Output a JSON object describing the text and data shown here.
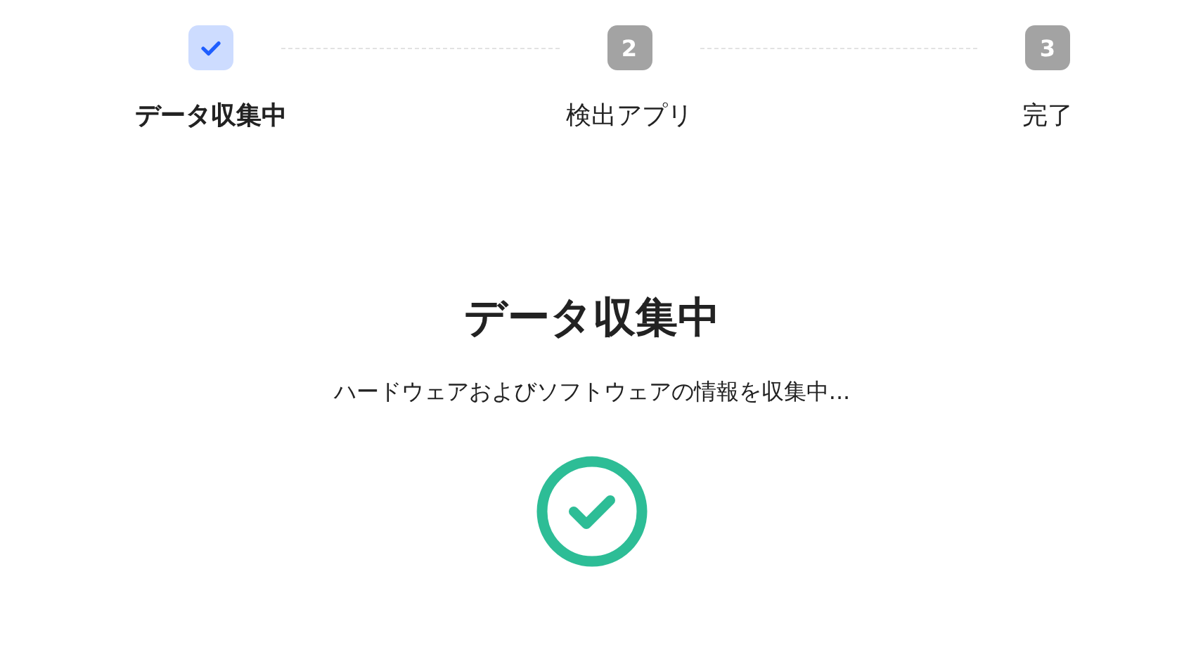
{
  "steps": [
    {
      "label": "データ収集中",
      "done": true,
      "selected": true
    },
    {
      "number": "2",
      "label": "検出アプリ",
      "done": false,
      "selected": false
    },
    {
      "number": "3",
      "label": "完了",
      "done": false,
      "selected": false
    }
  ],
  "title": "データ収集中",
  "message": "ハードウェアおよびソフトウェアの情報を収集中...",
  "result": {
    "success": true
  }
}
